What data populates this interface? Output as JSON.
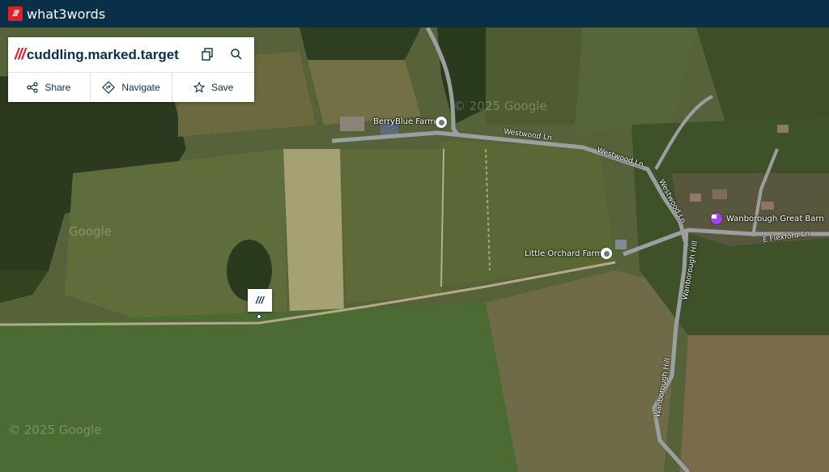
{
  "app": {
    "logo_mark": "///",
    "logo_text": "what3words"
  },
  "address": {
    "slashes": "///",
    "words": "cuddling.marked.target"
  },
  "actions": [
    {
      "label": "Share",
      "icon": "share-icon"
    },
    {
      "label": "Navigate",
      "icon": "navigate-icon"
    },
    {
      "label": "Save",
      "icon": "star-icon"
    }
  ],
  "map": {
    "roads": {
      "westwood_1": "Westwood Ln",
      "westwood_2": "Westwood Ln",
      "westwood_3": "Westwood Ln",
      "wanborough_1": "Wanborough Hill",
      "wanborough_2": "Wanborough Hill",
      "flexford": "E Flexford Ln"
    },
    "pois": {
      "berryblue": "BerryBlue Farm",
      "little_orchard": "Little Orchard Farm",
      "great_barn": "Wanborough Great Barn"
    },
    "marker_label": "///",
    "watermark_1": "© 2025 Google",
    "watermark_2": "© 2025 Google",
    "watermark_3": "Google"
  },
  "colors": {
    "topbar": "#0a3049",
    "brand_red": "#e11f26",
    "pin_purple": "#a142f4"
  }
}
